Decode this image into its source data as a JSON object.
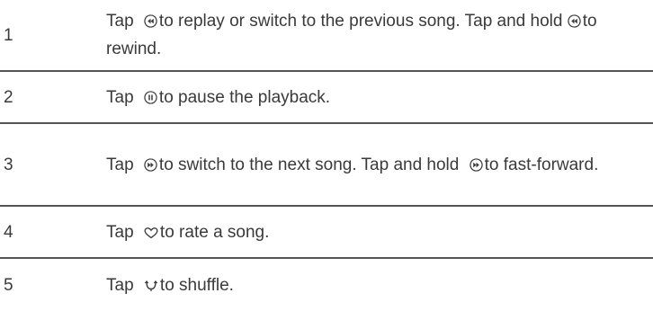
{
  "rows": [
    {
      "number": "1",
      "segments": [
        {
          "text": "Tap "
        },
        {
          "icon": "previous-icon"
        },
        {
          "text": "to replay or switch to the previous song. Tap and hold "
        },
        {
          "icon": "previous-icon"
        },
        {
          "text": "to rewind."
        }
      ]
    },
    {
      "number": "2",
      "segments": [
        {
          "text": "Tap "
        },
        {
          "icon": "pause-icon"
        },
        {
          "text": "to pause the playback."
        }
      ]
    },
    {
      "number": "3",
      "segments": [
        {
          "text": "Tap "
        },
        {
          "icon": "next-icon"
        },
        {
          "text": "to switch to the next song. Tap and hold "
        },
        {
          "icon": "next-icon"
        },
        {
          "text": "to fast-forward."
        }
      ]
    },
    {
      "number": "4",
      "segments": [
        {
          "text": "Tap "
        },
        {
          "icon": "heart-icon"
        },
        {
          "text": "to rate a song."
        }
      ]
    },
    {
      "number": "5",
      "segments": [
        {
          "text": "Tap "
        },
        {
          "icon": "shuffle-icon"
        },
        {
          "text": "to shuffle."
        }
      ]
    }
  ]
}
